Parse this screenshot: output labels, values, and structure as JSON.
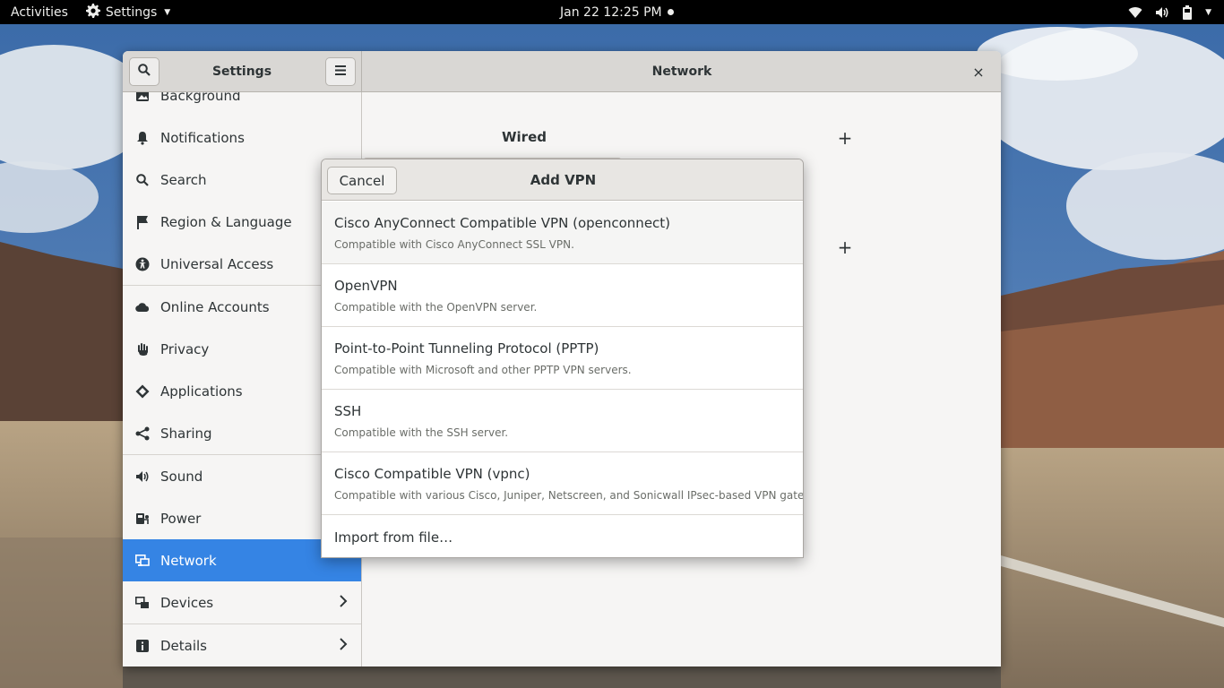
{
  "topbar": {
    "activities": "Activities",
    "app_name": "Settings",
    "clock": "Jan 22  12:25 PM"
  },
  "window": {
    "sidebar_title": "Settings",
    "panel_title": "Network",
    "close_symbol": "×"
  },
  "sidebar": {
    "items": [
      {
        "label": "Background",
        "icon": "background-icon"
      },
      {
        "label": "Notifications",
        "icon": "bell-icon"
      },
      {
        "label": "Search",
        "icon": "search-icon"
      },
      {
        "label": "Region & Language",
        "icon": "flag-icon"
      },
      {
        "label": "Universal Access",
        "icon": "accessibility-icon"
      },
      {
        "label": "Online Accounts",
        "icon": "cloud-icon"
      },
      {
        "label": "Privacy",
        "icon": "hand-icon"
      },
      {
        "label": "Applications",
        "icon": "applications-icon"
      },
      {
        "label": "Sharing",
        "icon": "share-icon"
      },
      {
        "label": "Sound",
        "icon": "speaker-icon"
      },
      {
        "label": "Power",
        "icon": "power-icon"
      },
      {
        "label": "Network",
        "icon": "network-icon",
        "active": true
      },
      {
        "label": "Devices",
        "icon": "devices-icon",
        "submenu": true
      },
      {
        "label": "Details",
        "icon": "info-icon",
        "submenu": true
      }
    ]
  },
  "content": {
    "wired_title": "Wired"
  },
  "dialog": {
    "title": "Add VPN",
    "cancel_label": "Cancel",
    "options": [
      {
        "name": "Cisco AnyConnect Compatible VPN (openconnect)",
        "description": "Compatible with Cisco AnyConnect SSL VPN."
      },
      {
        "name": "OpenVPN",
        "description": "Compatible with the OpenVPN server."
      },
      {
        "name": "Point-to-Point Tunneling Protocol (PPTP)",
        "description": "Compatible with Microsoft and other PPTP VPN servers."
      },
      {
        "name": "SSH",
        "description": "Compatible with the SSH server."
      },
      {
        "name": "Cisco Compatible VPN (vpnc)",
        "description": "Compatible with various Cisco, Juniper, Netscreen, and Sonicwall IPsec-based VPN gateways."
      }
    ],
    "import_label": "Import from file…"
  },
  "colors": {
    "accent": "#3584e4",
    "topbar": "#000000",
    "headerbar": "#d9d7d4"
  }
}
